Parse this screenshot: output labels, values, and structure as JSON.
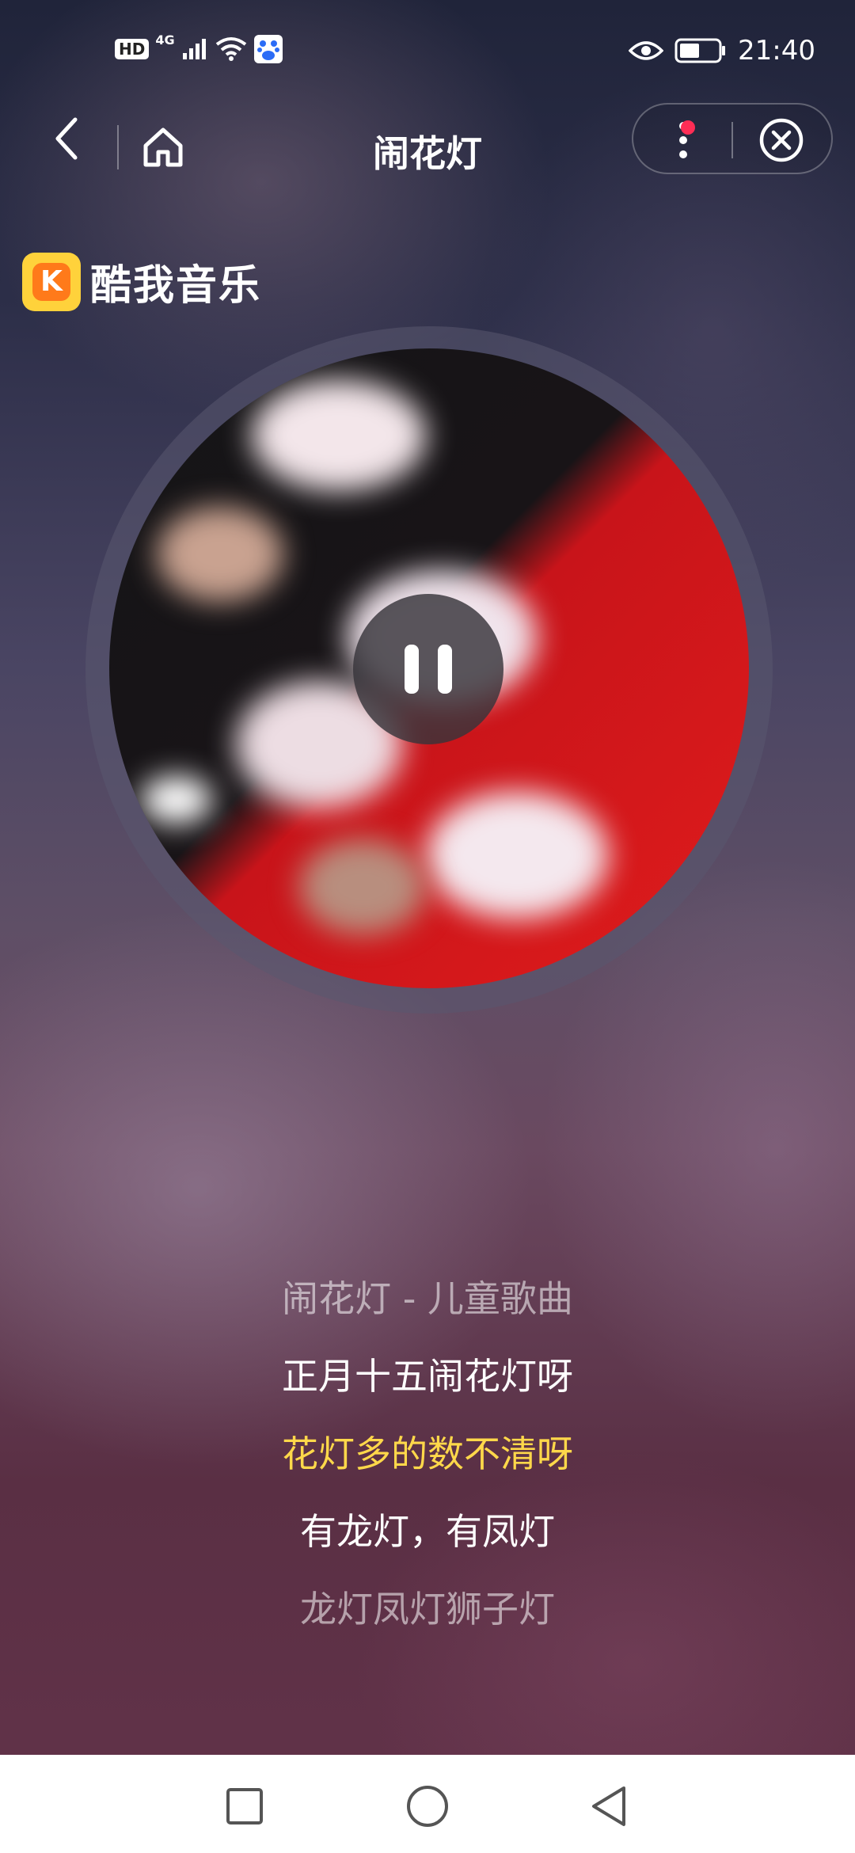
{
  "status_bar": {
    "left_badge": "HD",
    "network": "4G",
    "time": "21:40",
    "icons": [
      "hd-icon",
      "signal-icon",
      "wifi-icon",
      "baidu-icon",
      "eye-icon",
      "battery-icon"
    ]
  },
  "header": {
    "title": "闹花灯",
    "back_icon": "chevron-left-icon",
    "home_icon": "home-icon",
    "more_icon": "more-vertical-icon",
    "close_icon": "close-circle-icon"
  },
  "brand": {
    "logo_letter": "K",
    "name": "酷我音乐"
  },
  "player": {
    "state": "playing",
    "control_icon": "pause-icon"
  },
  "lyrics": {
    "lines": [
      "闹花灯 - 儿童歌曲",
      "正月十五闹花灯呀",
      "花灯多的数不清呀",
      "有龙灯，有凤灯",
      "龙灯凤灯狮子灯"
    ],
    "active_index": 2
  },
  "nav_bar": {
    "icons": [
      "recent-apps-icon",
      "home-circle-icon",
      "back-triangle-icon"
    ]
  },
  "colors": {
    "active_lyric": "#ffd84a",
    "notification_dot": "#ff2d55",
    "brand_yellow": "#ffd23b",
    "brand_orange": "#ff7a1a"
  }
}
